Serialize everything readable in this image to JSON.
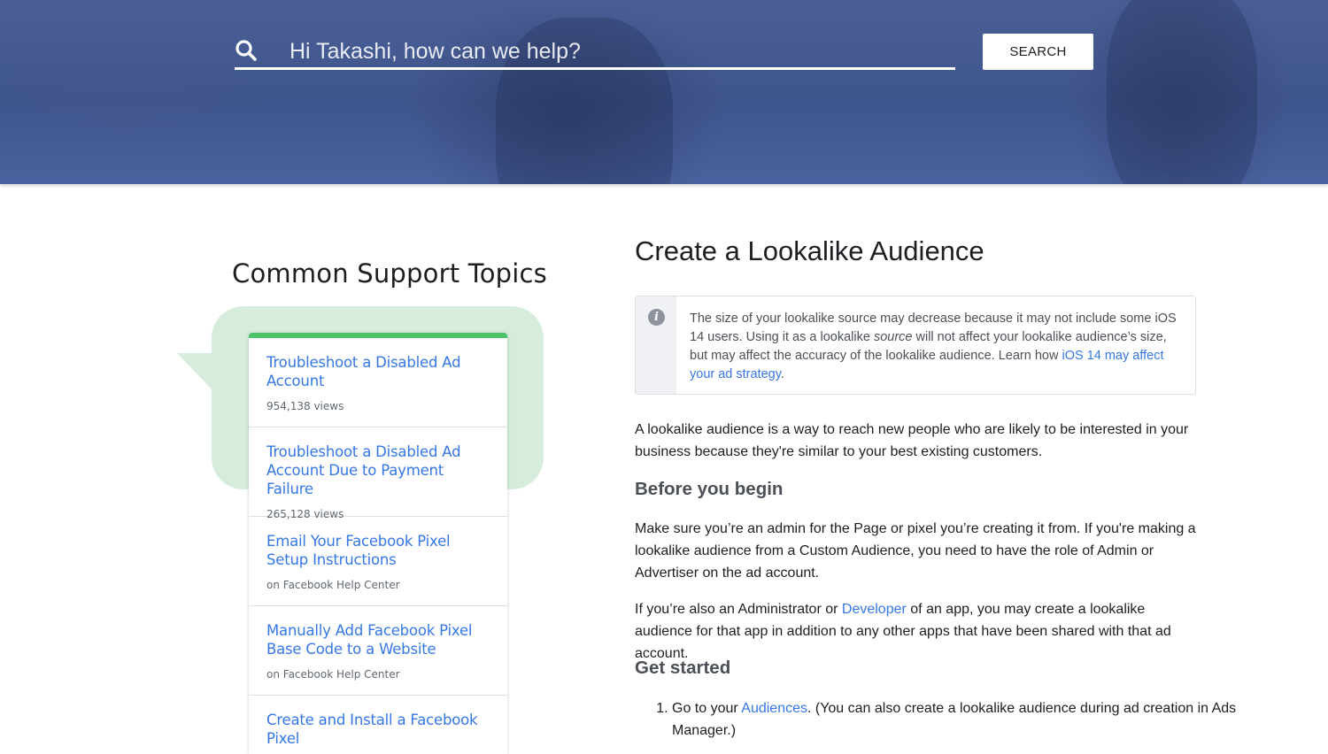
{
  "search": {
    "placeholder": "Hi Takashi, how can we help?",
    "button_label": "SEARCH",
    "icon": "search-icon"
  },
  "sidebar": {
    "title": "Common Support Topics",
    "accent_color": "#4cc36a",
    "bubble_color": "#d6ecdc",
    "topics": [
      {
        "label": "Troubleshoot a Disabled Ad Account",
        "meta": "954,138 views"
      },
      {
        "label": "Troubleshoot a Disabled Ad Account Due to Payment Failure",
        "meta": "265,128 views"
      },
      {
        "label": "Email Your Facebook Pixel Setup Instructions",
        "meta": "on Facebook Help Center"
      },
      {
        "label": "Manually Add Facebook Pixel Base Code to a Website",
        "meta": "on Facebook Help Center"
      },
      {
        "label": "Create and Install a Facebook Pixel",
        "meta": ""
      }
    ]
  },
  "article": {
    "title": "Create a Lookalike Audience",
    "note": {
      "icon": "info-icon",
      "text_1": "The size of your lookalike source may decrease because it may not include some iOS 14 users. Using it as a lookalike ",
      "text_emphasis": "source",
      "text_2": " will not affect your lookalike audience’s size, but may affect the accuracy of the lookalike audience. Learn how ",
      "link": "iOS 14 may affect your ad strategy",
      "text_3": "."
    },
    "intro": "A lookalike audience is a way to reach new people who are likely to be interested in your business because they're similar to your best existing customers.",
    "before_heading": "Before you begin",
    "before_p1": "Make sure you’re an admin for the Page or pixel you’re creating it from. If you're making a lookalike audience from a Custom Audience, you need to have the role of Admin or Advertiser on the ad account.",
    "before_p2_a": "If you’re also an Administrator or ",
    "before_p2_link": "Developer",
    "before_p2_b": " of an app, you may create a lookalike audience for that app in addition to any other apps that have been shared with that ad account.",
    "started_heading": "Get started",
    "step1_a": "Go to your ",
    "step1_link": "Audiences",
    "step1_b": ". (You can also create a lookalike audience during ad creation in Ads Manager.)",
    "link_color": "#3578e5"
  }
}
